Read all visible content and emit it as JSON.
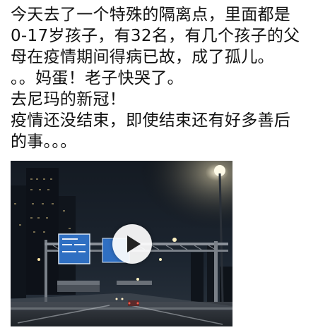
{
  "post": {
    "lines": [
      "今天去了一个特殊的隔离点，里面都是",
      "0-17岁孩子，有32名，有几个孩子的父",
      "母在疫情期间得病已故，成了孤儿。",
      "。。妈蛋！老子快哭了。",
      "去尼玛的新冠！",
      "疫情还没结束，即使结束还有好多善后",
      "的事。。。"
    ]
  },
  "video": {
    "play_icon": "play-icon",
    "sign_color": "#2f6fc2"
  }
}
